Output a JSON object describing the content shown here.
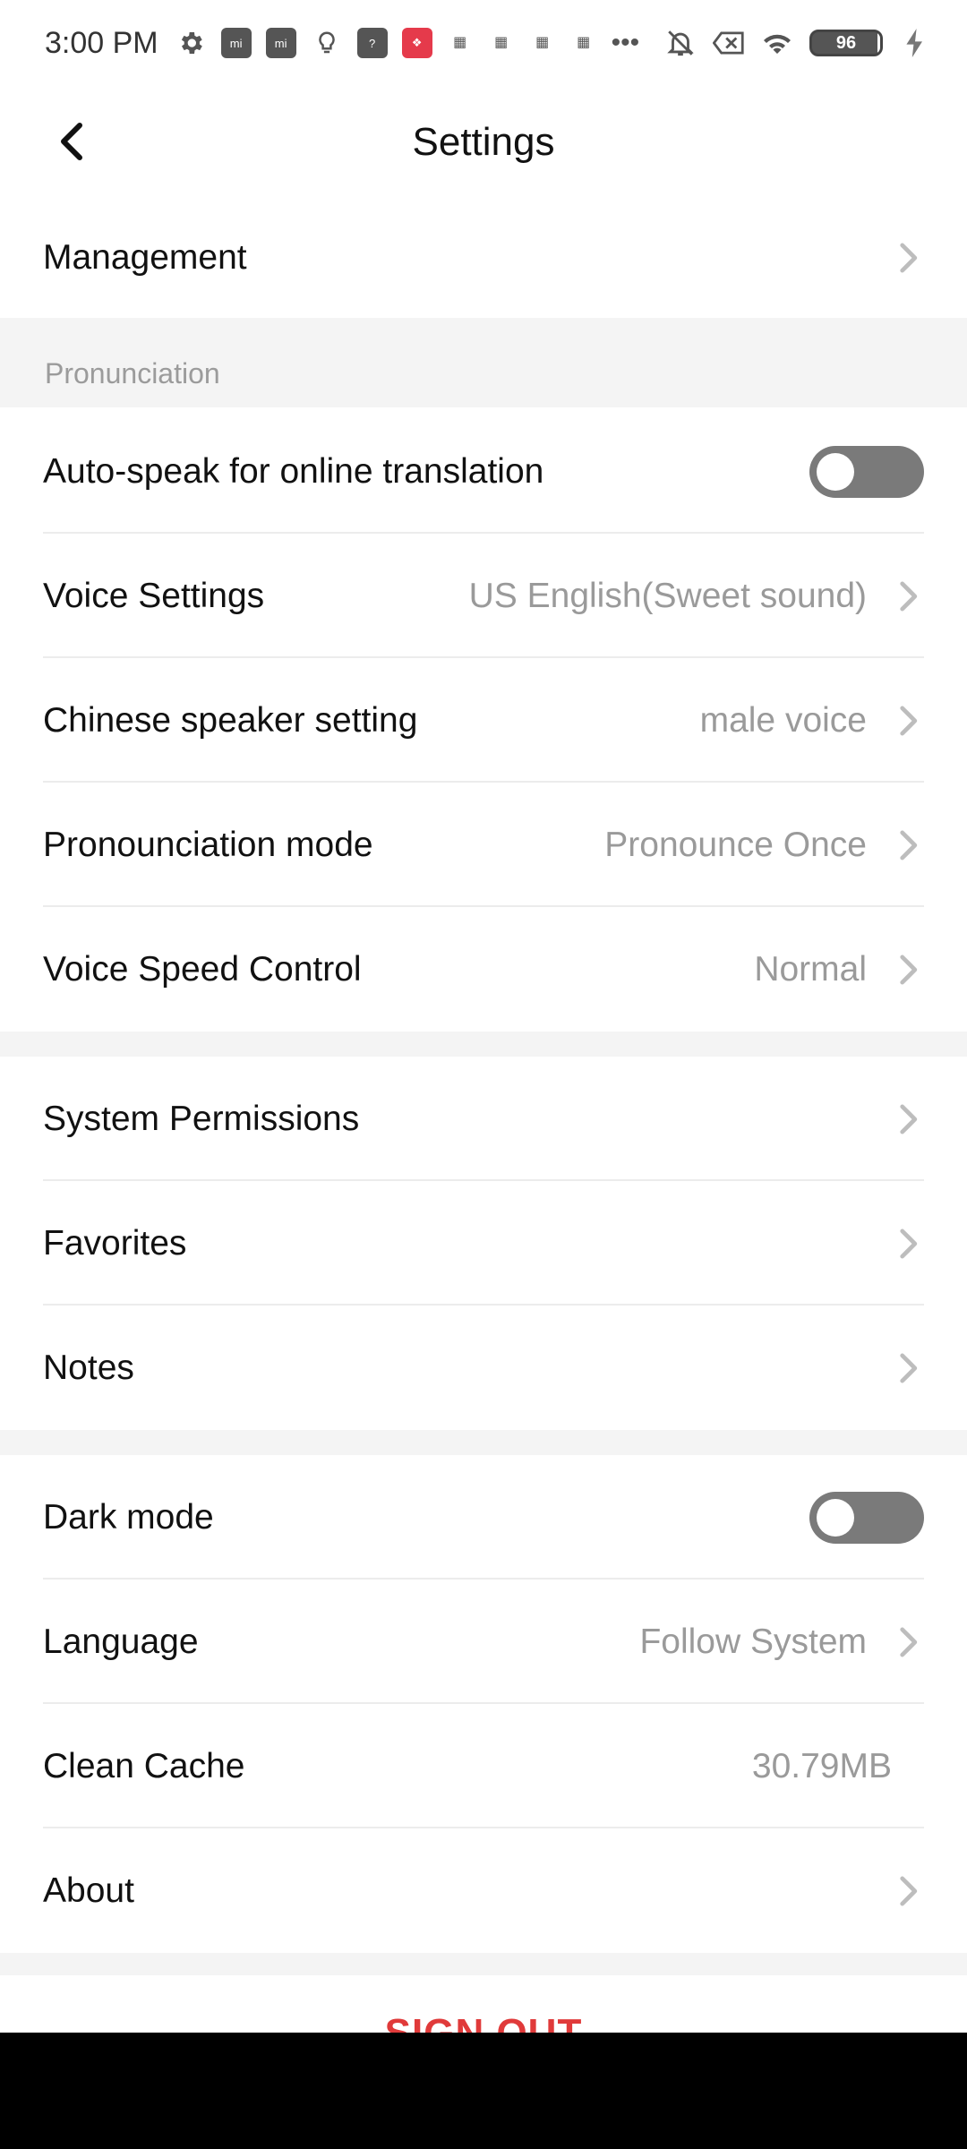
{
  "status_bar": {
    "time": "3:00 PM",
    "battery_level": "96",
    "icons": [
      "gear-icon",
      "mi-app-icon",
      "mi-app-icon",
      "bulb-icon",
      "question-icon",
      "red-app-icon",
      "app-icon",
      "app-icon",
      "app-icon",
      "app-icon",
      "more-icon",
      "mute-icon",
      "close-box-icon",
      "wifi-icon",
      "battery-icon",
      "charging-icon"
    ]
  },
  "header": {
    "title": "Settings"
  },
  "rows": {
    "management": {
      "label": "Management"
    },
    "pronunciation_section": "Pronunciation",
    "auto_speak": {
      "label": "Auto-speak for online translation",
      "enabled": false
    },
    "voice_settings": {
      "label": "Voice Settings",
      "value": "US English(Sweet sound)"
    },
    "chinese_speaker": {
      "label": "Chinese speaker setting",
      "value": "male voice"
    },
    "pronounciation_mode": {
      "label": "Pronounciation mode",
      "value": "Pronounce Once"
    },
    "voice_speed": {
      "label": "Voice Speed Control",
      "value": "Normal"
    },
    "system_permissions": {
      "label": "System Permissions"
    },
    "favorites": {
      "label": "Favorites"
    },
    "notes": {
      "label": "Notes"
    },
    "dark_mode": {
      "label": "Dark mode",
      "enabled": false
    },
    "language": {
      "label": "Language",
      "value": "Follow System"
    },
    "clean_cache": {
      "label": "Clean Cache",
      "value": "30.79MB"
    },
    "about": {
      "label": "About"
    }
  },
  "sign_out": "SIGN OUT",
  "colors": {
    "accent_red": "#e03a3a",
    "toggle_off": "#7a7a7a",
    "section_bg": "#f4f4f4"
  }
}
